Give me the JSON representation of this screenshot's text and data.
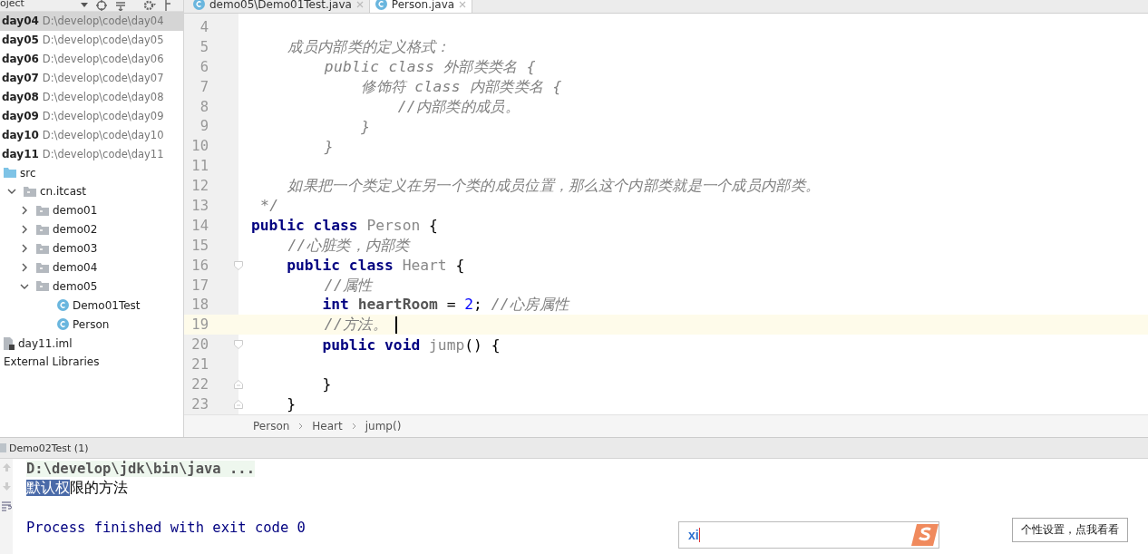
{
  "project_panel": {
    "title": "oject"
  },
  "modules": [
    {
      "name": "day04",
      "path": "D:\\develop\\code\\day04",
      "selected": true
    },
    {
      "name": "day05",
      "path": "D:\\develop\\code\\day05",
      "selected": false
    },
    {
      "name": "day06",
      "path": "D:\\develop\\code\\day06",
      "selected": false
    },
    {
      "name": "day07",
      "path": "D:\\develop\\code\\day07",
      "selected": false
    },
    {
      "name": "day08",
      "path": "D:\\develop\\code\\day08",
      "selected": false
    },
    {
      "name": "day09",
      "path": "D:\\develop\\code\\day09",
      "selected": false
    },
    {
      "name": "day10",
      "path": "D:\\develop\\code\\day10",
      "selected": false
    },
    {
      "name": "day11",
      "path": "D:\\develop\\code\\day11",
      "selected": false
    }
  ],
  "tree": [
    {
      "label": "src",
      "kind": "source"
    },
    {
      "label": "cn.itcast",
      "kind": "package",
      "expanded": true,
      "children": [
        {
          "label": "demo01",
          "kind": "package",
          "expanded": false
        },
        {
          "label": "demo02",
          "kind": "package",
          "expanded": false
        },
        {
          "label": "demo03",
          "kind": "package",
          "expanded": false
        },
        {
          "label": "demo04",
          "kind": "package",
          "expanded": false
        },
        {
          "label": "demo05",
          "kind": "package",
          "expanded": true,
          "children": [
            {
              "label": "Demo01Test",
              "kind": "class"
            },
            {
              "label": "Person",
              "kind": "class"
            }
          ]
        }
      ]
    },
    {
      "label": "day11.iml",
      "kind": "module-file"
    },
    {
      "label": "External Libraries",
      "kind": "library"
    }
  ],
  "tabs": [
    {
      "label": "demo05\\Demo01Test.java",
      "selected": false
    },
    {
      "label": "Person.java",
      "selected": true
    }
  ],
  "code": [
    {
      "number": "4",
      "current": false
    },
    {
      "number": "5",
      "current": false,
      "tokens": [
        {
          "text": "    成员内部类的定义格式：",
          "kind": "comment"
        }
      ]
    },
    {
      "number": "6",
      "current": false,
      "tokens": [
        {
          "text": "        public class 外部类类名 {",
          "kind": "comment"
        }
      ]
    },
    {
      "number": "7",
      "current": false,
      "tokens": [
        {
          "text": "            修饰符 class 内部类类名 {",
          "kind": "comment"
        }
      ]
    },
    {
      "number": "8",
      "current": false,
      "tokens": [
        {
          "text": "                //内部类的成员。",
          "kind": "comment"
        }
      ]
    },
    {
      "number": "9",
      "current": false,
      "tokens": [
        {
          "text": "            }",
          "kind": "comment"
        }
      ]
    },
    {
      "number": "10",
      "current": false,
      "tokens": [
        {
          "text": "        }",
          "kind": "comment"
        }
      ]
    },
    {
      "number": "11",
      "current": false
    },
    {
      "number": "12",
      "current": false,
      "tokens": [
        {
          "text": "    如果把一个类定义在另一个类的成员位置，那么这个内部类就是一个成员内部类。",
          "kind": "comment"
        }
      ]
    },
    {
      "number": "13",
      "current": false,
      "tokens": [
        {
          "text": " */",
          "kind": "comment"
        }
      ]
    },
    {
      "number": "14",
      "current": false,
      "tokens": [
        {
          "text": "public class ",
          "kind": "keyword"
        },
        {
          "text": "Person",
          "kind": "ident"
        },
        {
          "text": " {",
          "kind": "plain"
        }
      ]
    },
    {
      "number": "15",
      "current": false,
      "tokens": [
        {
          "text": "    //心脏类，内部类",
          "kind": "comment"
        }
      ]
    },
    {
      "number": "16",
      "current": false,
      "kind": "fold-start",
      "tokens": [
        {
          "text": "    public class ",
          "kind": "keyword"
        },
        {
          "text": "Heart",
          "kind": "ident"
        },
        {
          "text": " {",
          "kind": "plain"
        }
      ]
    },
    {
      "number": "17",
      "current": false,
      "tokens": [
        {
          "text": "        //属性",
          "kind": "comment"
        }
      ]
    },
    {
      "number": "18",
      "current": false,
      "tokens": [
        {
          "text": "        int ",
          "kind": "keyword"
        },
        {
          "text": "heartRoom",
          "kind": "field"
        },
        {
          "text": " = ",
          "kind": "plain"
        },
        {
          "text": "2",
          "kind": "number"
        },
        {
          "text": "; ",
          "kind": "plain"
        },
        {
          "text": "//心房属性",
          "kind": "comment"
        }
      ]
    },
    {
      "number": "19",
      "current": true,
      "tokens": [
        {
          "text": "        //方法。",
          "kind": "comment"
        }
      ]
    },
    {
      "number": "20",
      "current": false,
      "kind": "fold-start",
      "tokens": [
        {
          "text": "        public void ",
          "kind": "keyword"
        },
        {
          "text": "jump",
          "kind": "ident"
        },
        {
          "text": "() {",
          "kind": "plain"
        }
      ]
    },
    {
      "number": "21",
      "current": false
    },
    {
      "number": "22",
      "current": false,
      "kind": "fold-end",
      "tokens": [
        {
          "text": "        }",
          "kind": "plain"
        }
      ]
    },
    {
      "number": "23",
      "current": false,
      "kind": "fold-end",
      "tokens": [
        {
          "text": "    }",
          "kind": "plain"
        }
      ]
    }
  ],
  "breadcrumbs": [
    "Person",
    "Heart",
    "jump()"
  ],
  "run_panel": {
    "title": "Demo02Test (1)"
  },
  "console": [
    {
      "kind": "command",
      "parts": [
        {
          "text": "D:\\develop\\jdk\\bin\\java ...",
          "selected": false
        }
      ]
    },
    {
      "kind": "output",
      "parts": [
        {
          "text": "默认权",
          "selected": true
        },
        {
          "text": "限的方法",
          "selected": false
        }
      ]
    },
    {
      "kind": "blank"
    },
    {
      "kind": "exit",
      "parts": [
        {
          "text": "Process finished with exit code 0",
          "selected": false
        }
      ]
    }
  ],
  "ime": {
    "input": "xi",
    "button": "个性设置，点我看看"
  }
}
